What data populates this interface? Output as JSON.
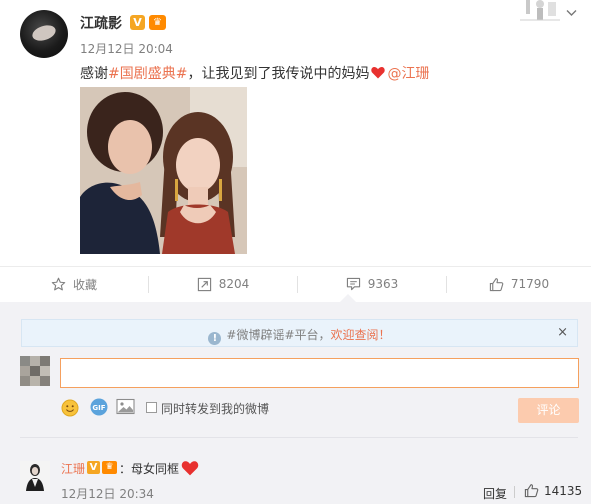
{
  "post": {
    "username": "江疏影",
    "verified_badge": "V",
    "member_badge": "crown-icon",
    "time": "12月12日 20:04",
    "text_prefix": "感谢",
    "topic": "#国剧盛典#",
    "text_middle": "，让我见到了我传说中的妈妈",
    "mention": "@江珊",
    "heart": "red-heart-icon"
  },
  "actions": {
    "favorite_label": "收藏",
    "repost_count": "8204",
    "comment_count": "9363",
    "like_count": "71790"
  },
  "notice": {
    "text": "#微博辟谣#平台，",
    "link": "欢迎查阅！",
    "close": "×"
  },
  "composer": {
    "input_value": "",
    "repost_option_label": "同时转发到我的微博",
    "submit_label": "评论"
  },
  "comments": [
    {
      "username": "江珊",
      "badge": "V",
      "colon": "：",
      "text": "母女同框",
      "time": "12月12日 20:34",
      "reply_label": "回复",
      "like_count": "14135"
    }
  ],
  "colors": {
    "accent": "#eb7350",
    "badge_gold": "#f5a623",
    "comment_area_bg": "#f2f2f5",
    "notice_bg": "#eaf3fb",
    "input_border": "#f5a05e",
    "submit_disabled": "#fccbae",
    "heart": "#e8312f"
  }
}
